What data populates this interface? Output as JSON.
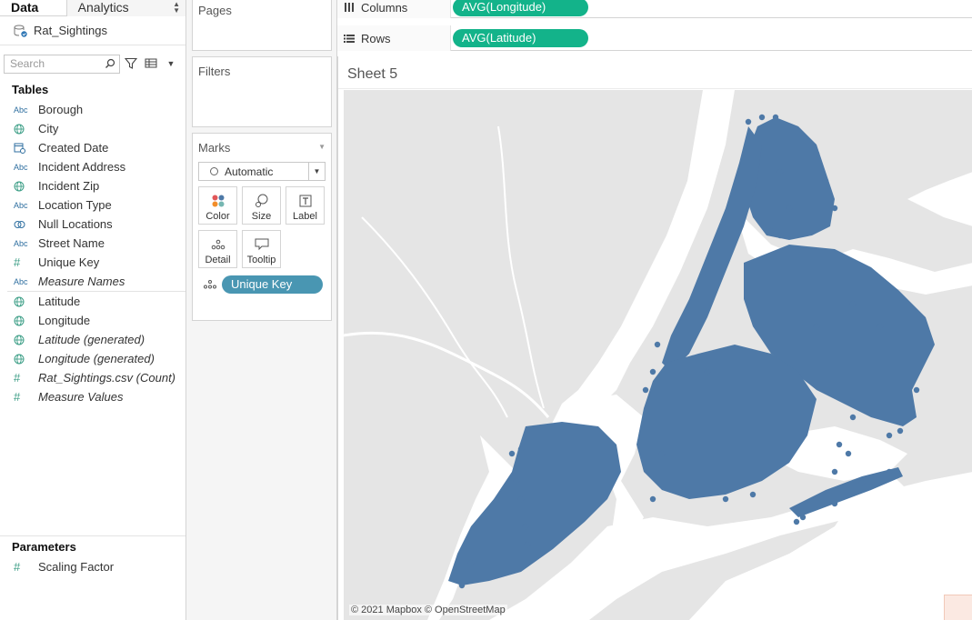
{
  "tabs": {
    "data": "Data",
    "analytics": "Analytics"
  },
  "datasource": {
    "name": "Rat_Sightings"
  },
  "search": {
    "placeholder": "Search"
  },
  "tables": {
    "title": "Tables",
    "fields": [
      {
        "type": "Abc",
        "name": "Borough"
      },
      {
        "type": "globe",
        "name": "City"
      },
      {
        "type": "date",
        "name": "Created Date"
      },
      {
        "type": "Abc",
        "name": "Incident Address"
      },
      {
        "type": "globe",
        "name": "Incident Zip"
      },
      {
        "type": "Abc",
        "name": "Location Type"
      },
      {
        "type": "link",
        "name": "Null Locations"
      },
      {
        "type": "Abc",
        "name": "Street Name"
      },
      {
        "type": "#",
        "name": "Unique Key"
      },
      {
        "type": "Abc",
        "name": "Measure Names"
      }
    ],
    "measures": [
      {
        "type": "globe",
        "name": "Latitude"
      },
      {
        "type": "globe",
        "name": "Longitude"
      },
      {
        "type": "globe",
        "name": "Latitude (generated)"
      },
      {
        "type": "globe",
        "name": "Longitude (generated)"
      },
      {
        "type": "#",
        "name": "Rat_Sightings.csv (Count)"
      },
      {
        "type": "#",
        "name": "Measure Values"
      }
    ]
  },
  "parameters": {
    "title": "Parameters",
    "items": [
      {
        "type": "#",
        "name": "Scaling Factor"
      }
    ]
  },
  "cards": {
    "pages": "Pages",
    "filters": "Filters",
    "marks": "Marks",
    "mark_type": "Automatic",
    "mark_buttons": [
      "Color",
      "Size",
      "Label",
      "Detail",
      "Tooltip"
    ],
    "detail_pill": "Unique Key"
  },
  "shelves": {
    "columns_label": "Columns",
    "columns_pill": "AVG(Longitude)",
    "rows_label": "Rows",
    "rows_pill": "AVG(Latitude)"
  },
  "sheet": {
    "title": "Sheet 5",
    "attribution": "© 2021 Mapbox © OpenStreetMap"
  },
  "colors": {
    "mark": "#4e79a7",
    "dimension_pill": "#4996b2",
    "measure_pill": "#13b38a",
    "map_land": "#e5e5e5",
    "map_water": "#ffffff"
  }
}
